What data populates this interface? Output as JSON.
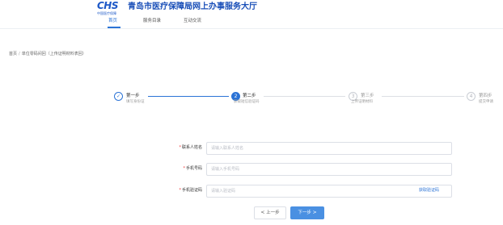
{
  "header": {
    "logo_text": "CHS",
    "logo_subtext": "中国医疗保障",
    "site_title": "青岛市医疗保障局网上办事服务大厅",
    "nav": [
      {
        "label": "首页",
        "active": true
      },
      {
        "label": "服务目录",
        "active": false
      },
      {
        "label": "互动交流",
        "active": false
      }
    ]
  },
  "breadcrumb": {
    "home": "首页",
    "separator": "/",
    "current": "单位零码间回（上传证明材料表回）"
  },
  "steps": [
    {
      "number": "✓",
      "title": "第一步",
      "desc": "填写身份证",
      "state": "done"
    },
    {
      "number": "2",
      "title": "第二步",
      "desc": "获取短信验证码",
      "state": "current"
    },
    {
      "number": "3",
      "title": "第三步",
      "desc": "上传证明材料",
      "state": "pending"
    },
    {
      "number": "4",
      "title": "第四步",
      "desc": "提交申请",
      "state": "pending"
    }
  ],
  "form": {
    "required_mark": "*",
    "name_label": "联系人姓名",
    "name_placeholder": "请输入联系人姓名",
    "phone_label": "手机号码",
    "phone_placeholder": "请输入手机号码",
    "code_label": "手机验证码",
    "code_placeholder": "请输入验证码",
    "get_code_label": "获取验证码"
  },
  "buttons": {
    "prev_icon": "chevron-left-icon",
    "prev_chevron": "<",
    "prev_label": "上一步",
    "next_label": "下一步",
    "next_icon": "chevron-right-icon",
    "next_chevron": ">"
  },
  "colors": {
    "accent": "#2b73d6",
    "title": "#1a4fb8",
    "next_button": "#4a90e2",
    "required": "#e33333"
  }
}
